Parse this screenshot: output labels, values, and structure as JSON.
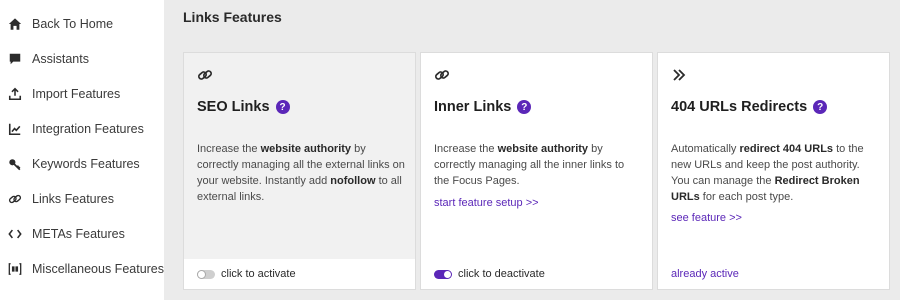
{
  "sidebar": {
    "items": [
      {
        "label": "Back To Home",
        "icon": "home-icon"
      },
      {
        "label": "Assistants",
        "icon": "chat-icon"
      },
      {
        "label": "Import Features",
        "icon": "import-icon"
      },
      {
        "label": "Integration Features",
        "icon": "chart-icon"
      },
      {
        "label": "Keywords Features",
        "icon": "key-icon"
      },
      {
        "label": "Links Features",
        "icon": "link-icon"
      },
      {
        "label": "METAs Features",
        "icon": "code-icon"
      },
      {
        "label": "Miscellaneous Features",
        "icon": "misc-icon"
      }
    ]
  },
  "page": {
    "title": "Links Features"
  },
  "cards": [
    {
      "icon": "link-icon",
      "title": "SEO Links",
      "help": "?",
      "desc": {
        "p1": "Increase the ",
        "b1": "website authority",
        "p2": " by correctly managing all the external links on your website. Instantly add ",
        "b2": "nofollow",
        "p3": " to all external links."
      },
      "toggle_label": "click to activate",
      "toggle_state": "off"
    },
    {
      "icon": "link-icon",
      "title": "Inner Links",
      "help": "?",
      "desc": {
        "p1": "Increase the ",
        "b1": "website authority",
        "p2": " by correctly managing all the inner links to the Focus Pages."
      },
      "link": "start feature setup >>",
      "toggle_label": "click to deactivate",
      "toggle_state": "on"
    },
    {
      "icon": "double-chevron-icon",
      "title": "404 URLs Redirects",
      "help": "?",
      "desc": {
        "p1": "Automatically ",
        "b1": "redirect 404 URLs",
        "p2": " to the new URLs and keep the post authority. You can manage the ",
        "b2": "Redirect Broken URLs",
        "p3": " for each post type."
      },
      "link": "see feature >>",
      "status": "already active"
    }
  ],
  "colors": {
    "accent": "#5b27b8",
    "background": "#ebebeb"
  }
}
